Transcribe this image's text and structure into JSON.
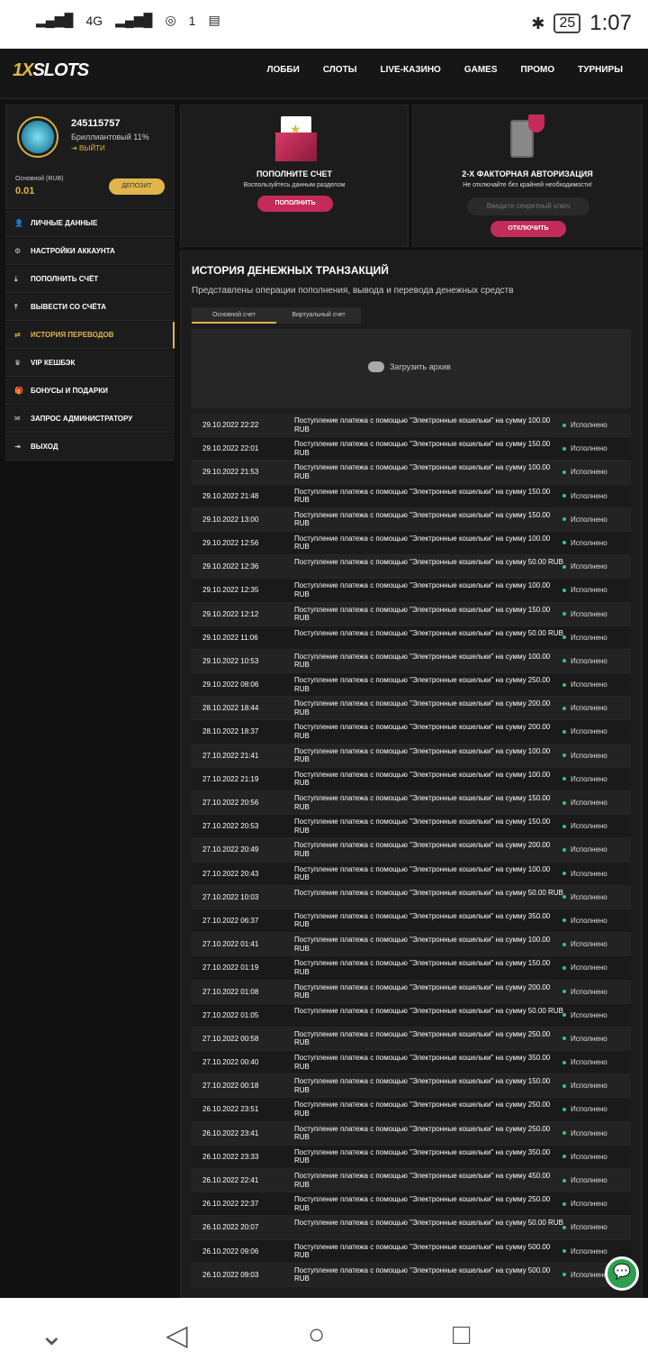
{
  "statusbar": {
    "network": "4G",
    "notif_count": "1",
    "battery": "25",
    "time": "1:07"
  },
  "header": {
    "logo_prefix": "1X",
    "logo_main": "SLOTS",
    "nav": [
      "ЛОББИ",
      "СЛОТЫ",
      "LIVE-КАЗИНО",
      "GAMES",
      "ПРОМО",
      "ТУРНИРЫ"
    ]
  },
  "profile": {
    "id": "245115757",
    "rank": "Бриллиантовый 11%",
    "logout": "ВЫЙТИ",
    "balance_label": "Основной (RUB)",
    "balance_value": "0.01",
    "deposit": "ДЕПОЗИТ"
  },
  "menu": [
    {
      "label": "ЛИЧНЫЕ ДАННЫЕ",
      "icon": "user-add-icon"
    },
    {
      "label": "НАСТРОЙКИ АККАУНТА",
      "icon": "gears-icon"
    },
    {
      "label": "ПОПОЛНИТЬ СЧЁТ",
      "icon": "download-icon"
    },
    {
      "label": "ВЫВЕСТИ СО СЧЁТА",
      "icon": "upload-icon"
    },
    {
      "label": "ИСТОРИЯ ПЕРЕВОДОВ",
      "icon": "transfer-icon"
    },
    {
      "label": "VIP КЕШБЭК",
      "icon": "crown-icon"
    },
    {
      "label": "БОНУСЫ И ПОДАРКИ",
      "icon": "gift-icon"
    },
    {
      "label": "ЗАПРОС АДМИНИСТРАТОРУ",
      "icon": "mail-icon"
    },
    {
      "label": "ВЫХОД",
      "icon": "exit-icon"
    }
  ],
  "card_topup": {
    "title": "ПОПОЛНИТЕ СЧЕТ",
    "subtitle": "Воспользуйтесь данным разделом",
    "button": "ПОПОЛНИТЬ"
  },
  "card_2fa": {
    "title": "2-Х ФАКТОРНАЯ АВТОРИЗАЦИЯ",
    "subtitle": "Не отключайте без крайней необходимости!",
    "placeholder": "Введите секретный ключ",
    "button": "ОТКЛЮЧИТЬ"
  },
  "history": {
    "title": "ИСТОРИЯ ДЕНЕЖНЫХ ТРАНЗАКЦИЙ",
    "subtitle": "Представлены операции пополнения, вывода и перевода денежных средств",
    "tabs": [
      "Основной счет",
      "Виртуальный счет"
    ],
    "archive": "Загрузить архив",
    "status": "Исполнено",
    "rows": [
      {
        "date": "29.10.2022 22:22",
        "desc": "Поступление платежа с помощью \"Электронные кошельки\" на сумму 100.00 RUB"
      },
      {
        "date": "29.10.2022 22:01",
        "desc": "Поступление платежа с помощью \"Электронные кошельки\" на сумму 150.00 RUB"
      },
      {
        "date": "29.10.2022 21:53",
        "desc": "Поступление платежа с помощью \"Электронные кошельки\" на сумму 100.00 RUB"
      },
      {
        "date": "29.10.2022 21:48",
        "desc": "Поступление платежа с помощью \"Электронные кошельки\" на сумму 150.00 RUB"
      },
      {
        "date": "29.10.2022 13:00",
        "desc": "Поступление платежа с помощью \"Электронные кошельки\" на сумму 150.00 RUB"
      },
      {
        "date": "29.10.2022 12:56",
        "desc": "Поступление платежа с помощью \"Электронные кошельки\" на сумму 100.00 RUB"
      },
      {
        "date": "29.10.2022 12:36",
        "desc": "Поступление платежа с помощью \"Электронные кошельки\" на сумму 50.00 RUB"
      },
      {
        "date": "29.10.2022 12:35",
        "desc": "Поступление платежа с помощью \"Электронные кошельки\" на сумму 100.00 RUB"
      },
      {
        "date": "29.10.2022 12:12",
        "desc": "Поступление платежа с помощью \"Электронные кошельки\" на сумму 150.00 RUB"
      },
      {
        "date": "29.10.2022 11:06",
        "desc": "Поступление платежа с помощью \"Электронные кошельки\" на сумму 50.00 RUB"
      },
      {
        "date": "29.10.2022 10:53",
        "desc": "Поступление платежа с помощью \"Электронные кошельки\" на сумму 100.00 RUB"
      },
      {
        "date": "29.10.2022 08:06",
        "desc": "Поступление платежа с помощью \"Электронные кошельки\" на сумму 250.00 RUB"
      },
      {
        "date": "28.10.2022 18:44",
        "desc": "Поступление платежа с помощью \"Электронные кошельки\" на сумму 200.00 RUB"
      },
      {
        "date": "28.10.2022 18:37",
        "desc": "Поступление платежа с помощью \"Электронные кошельки\" на сумму 200.00 RUB"
      },
      {
        "date": "27.10.2022 21:41",
        "desc": "Поступление платежа с помощью \"Электронные кошельки\" на сумму 100.00 RUB"
      },
      {
        "date": "27.10.2022 21:19",
        "desc": "Поступление платежа с помощью \"Электронные кошельки\" на сумму 100.00 RUB"
      },
      {
        "date": "27.10.2022 20:56",
        "desc": "Поступление платежа с помощью \"Электронные кошельки\" на сумму 150.00 RUB"
      },
      {
        "date": "27.10.2022 20:53",
        "desc": "Поступление платежа с помощью \"Электронные кошельки\" на сумму 150.00 RUB"
      },
      {
        "date": "27.10.2022 20:49",
        "desc": "Поступление платежа с помощью \"Электронные кошельки\" на сумму 200.00 RUB"
      },
      {
        "date": "27.10.2022 20:43",
        "desc": "Поступление платежа с помощью \"Электронные кошельки\" на сумму 100.00 RUB"
      },
      {
        "date": "27.10.2022 10:03",
        "desc": "Поступление платежа с помощью \"Электронные кошельки\" на сумму 50.00 RUB"
      },
      {
        "date": "27.10.2022 06:37",
        "desc": "Поступление платежа с помощью \"Электронные кошельки\" на сумму 350.00 RUB"
      },
      {
        "date": "27.10.2022 01:41",
        "desc": "Поступление платежа с помощью \"Электронные кошельки\" на сумму 100.00 RUB"
      },
      {
        "date": "27.10.2022 01:19",
        "desc": "Поступление платежа с помощью \"Электронные кошельки\" на сумму 150.00 RUB"
      },
      {
        "date": "27.10.2022 01:08",
        "desc": "Поступление платежа с помощью \"Электронные кошельки\" на сумму 200.00 RUB"
      },
      {
        "date": "27.10.2022 01:05",
        "desc": "Поступление платежа с помощью \"Электронные кошельки\" на сумму 50.00 RUB"
      },
      {
        "date": "27.10.2022 00:58",
        "desc": "Поступление платежа с помощью \"Электронные кошельки\" на сумму 250.00 RUB"
      },
      {
        "date": "27.10.2022 00:40",
        "desc": "Поступление платежа с помощью \"Электронные кошельки\" на сумму 350.00 RUB"
      },
      {
        "date": "27.10.2022 00:18",
        "desc": "Поступление платежа с помощью \"Электронные кошельки\" на сумму 150.00 RUB"
      },
      {
        "date": "26.10.2022 23:51",
        "desc": "Поступление платежа с помощью \"Электронные кошельки\" на сумму 250.00 RUB"
      },
      {
        "date": "26.10.2022 23:41",
        "desc": "Поступление платежа с помощью \"Электронные кошельки\" на сумму 250.00 RUB"
      },
      {
        "date": "26.10.2022 23:33",
        "desc": "Поступление платежа с помощью \"Электронные кошельки\" на сумму 350.00 RUB"
      },
      {
        "date": "26.10.2022 22:41",
        "desc": "Поступление платежа с помощью \"Электронные кошельки\" на сумму 450.00 RUB"
      },
      {
        "date": "26.10.2022 22:37",
        "desc": "Поступление платежа с помощью \"Электронные кошельки\" на сумму 250.00 RUB"
      },
      {
        "date": "26.10.2022 20:07",
        "desc": "Поступление платежа с помощью \"Электронные кошельки\" на сумму 50.00 RUB"
      },
      {
        "date": "26.10.2022 09:06",
        "desc": "Поступление платежа с помощью \"Электронные кошельки\" на сумму 500.00 RUB"
      },
      {
        "date": "26.10.2022 09:03",
        "desc": "Поступление платежа с помощью \"Электронные кошельки\" на сумму 500.00 RUB"
      }
    ]
  },
  "colors": {
    "accent": "#e0b54a",
    "button": "#c42a5a",
    "status_ok": "#2ecc71"
  }
}
